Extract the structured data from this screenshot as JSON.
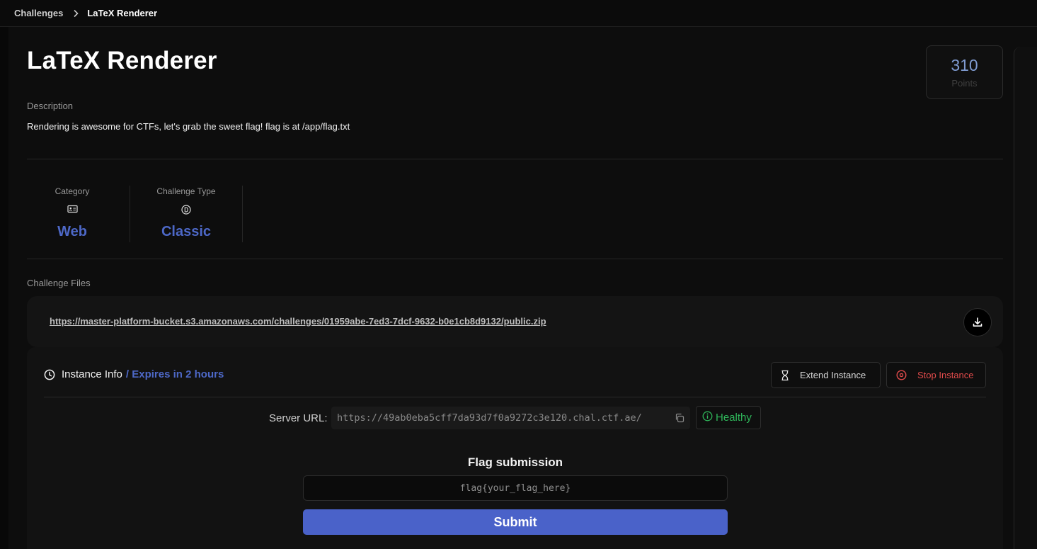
{
  "breadcrumb": {
    "parent": "Challenges",
    "current": "LaTeX Renderer"
  },
  "challenge": {
    "title": "LaTeX Renderer",
    "points_value": "310",
    "points_label": "Points",
    "description_label": "Description",
    "description": "Rendering is awesome for CTFs, let's grab the sweet flag! flag is at /app/flag.txt"
  },
  "meta": {
    "category_label": "Category",
    "category_icon": "id-card-icon",
    "category_value": "Web",
    "type_label": "Challenge Type",
    "type_icon": "circle-d-icon",
    "type_value": "Classic"
  },
  "files": {
    "label": "Challenge Files",
    "url": "https://master-platform-bucket.s3.amazonaws.com/challenges/01959abe-7ed3-7dcf-9632-b0e1cb8d9132/public.zip"
  },
  "instance": {
    "title": "Instance Info",
    "expires": "/ Expires in 2 hours",
    "extend_label": "Extend Instance",
    "stop_label": "Stop Instance",
    "server_label": "Server URL:",
    "server_url": "https://49ab0eba5cff7da93d7f0a9272c3e120.chal.ctf.ae/",
    "health": "Healthy"
  },
  "flag": {
    "title": "Flag submission",
    "placeholder": "flag{your_flag_here}",
    "submit_label": "Submit"
  },
  "colors": {
    "accent": "#4d68c7",
    "submit": "#4a62c9",
    "danger": "#e14b4b",
    "healthy": "#2fb65a",
    "background": "#0d0d0d"
  }
}
